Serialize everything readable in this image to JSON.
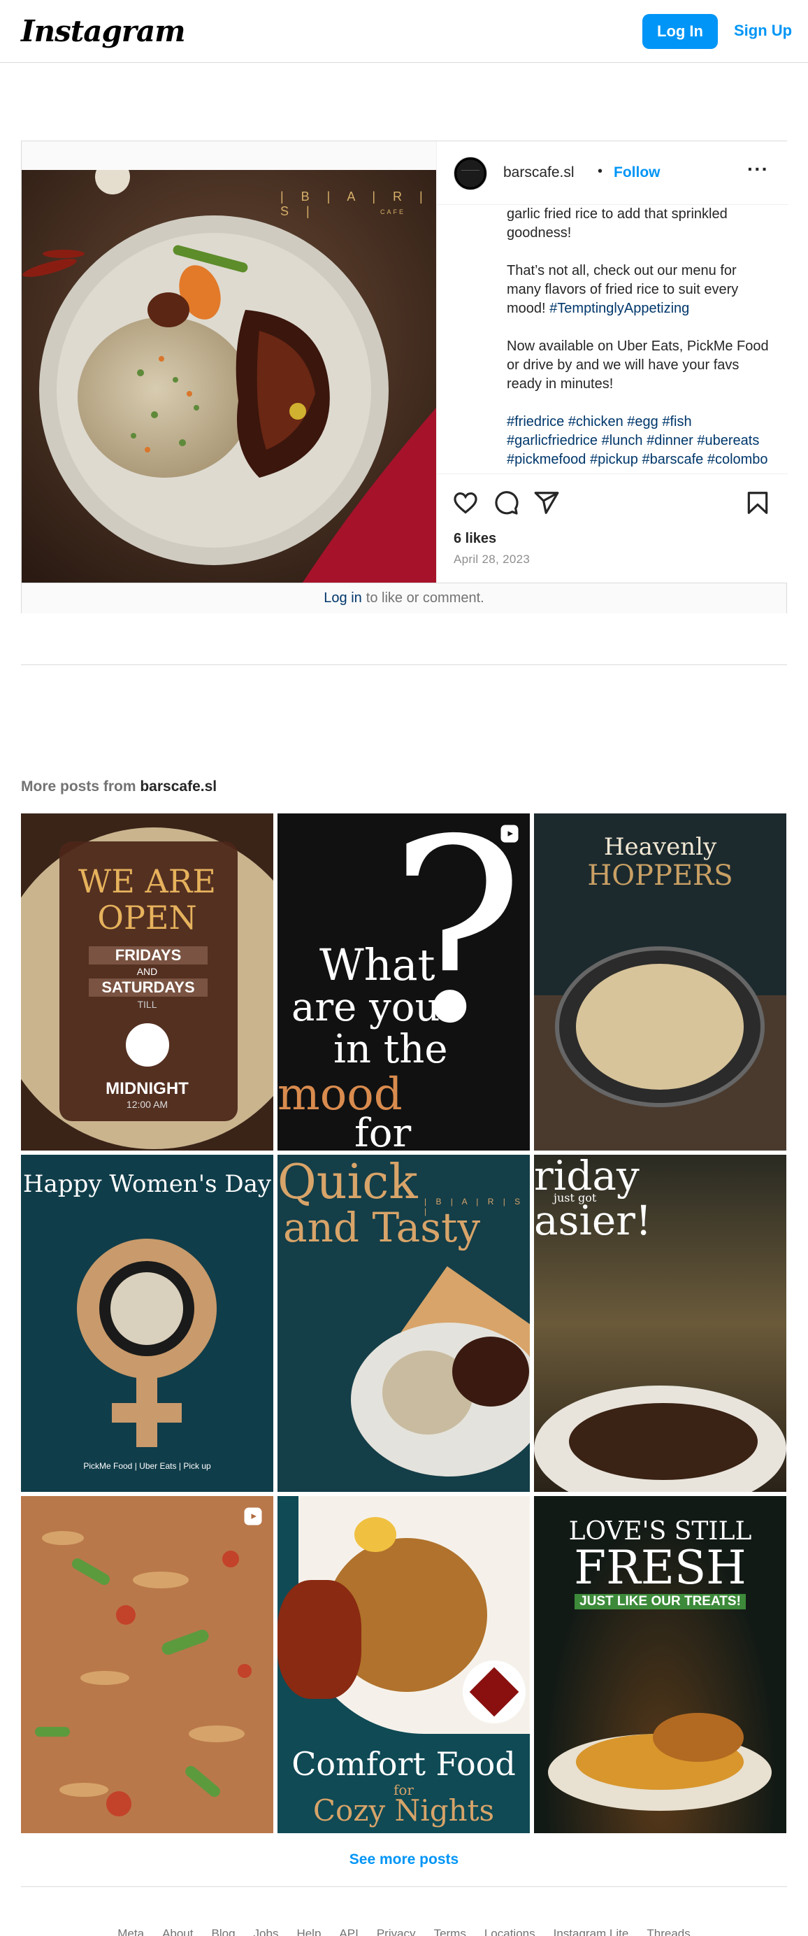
{
  "nav": {
    "logo": "Instagram",
    "login_label": "Log In",
    "signup_label": "Sign Up"
  },
  "post": {
    "username": "barscafe.sl",
    "separator": "•",
    "follow_label": "Follow",
    "more_label": "···",
    "image_brand": "| B | A | R | S |",
    "image_brand_sub": "CAFE",
    "caption": {
      "line1": "garlic fried rice to add that sprinkled goodness!",
      "para2": "That’s not all, check out our menu for many flavors of fried rice to suit every mood!",
      "para2_tag": "#TemptinglyAppetizing",
      "para3": "Now available on Uber Eats, PickMe Food or drive by and we will have your favs ready in minutes!",
      "hashtags": "#friedrice #chicken #egg #fish #garlicfriedrice #lunch #dinner #ubereats #pickmefood #pickup #barscafe #colombo"
    },
    "likes": "6 likes",
    "date": "April 28, 2023",
    "footer_login": "Log in",
    "footer_text": "to like or comment."
  },
  "more_posts": {
    "prefix": "More posts from",
    "username": "barscafe.sl",
    "tiles": [
      {
        "lines": [
          "WE ARE",
          "OPEN",
          "FRIDAYS",
          "AND",
          "SATURDAYS",
          "TILL",
          "MIDNIGHT",
          "12:00 AM"
        ]
      },
      {
        "lines": [
          "What",
          "are you",
          "in the",
          "mood",
          "for"
        ],
        "reel": true
      },
      {
        "lines": [
          "Heavenly",
          "HOPPERS"
        ]
      },
      {
        "lines": [
          "Happy Women's Day",
          "PickMe Food",
          "Uber Eats",
          "Pick up"
        ]
      },
      {
        "lines": [
          "Quick",
          "and Tasty",
          "| B | A | R | S |"
        ]
      },
      {
        "lines": [
          "riday",
          "just got",
          "asier!"
        ]
      },
      {
        "lines": [],
        "reel": true
      },
      {
        "lines": [
          "Comfort Food",
          "for",
          "Cozy Nights"
        ]
      },
      {
        "lines": [
          "LOVE'S STILL",
          "FRESH",
          "JUST LIKE OUR TREATS!"
        ]
      }
    ],
    "see_more_label": "See more posts"
  },
  "footer": {
    "links": [
      "Meta",
      "About",
      "Blog",
      "Jobs",
      "Help",
      "API",
      "Privacy",
      "Terms",
      "Locations",
      "Instagram Lite",
      "Threads"
    ]
  }
}
